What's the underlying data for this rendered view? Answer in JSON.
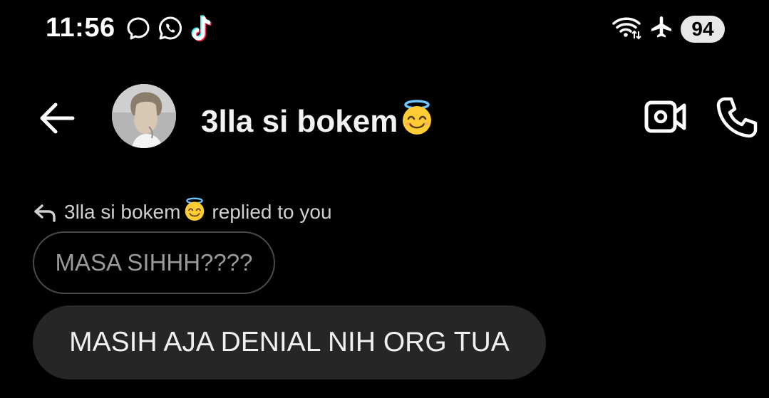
{
  "status_bar": {
    "time": "11:56",
    "left_icons": [
      "messenger-icon",
      "whatsapp-icon",
      "tiktok-icon"
    ],
    "right_icons": [
      "wifi-icon",
      "airplane-mode-icon"
    ],
    "battery_level": "94"
  },
  "header": {
    "contact_name": "3lla si bokem",
    "name_emoji": "smiling-face-with-halo-icon",
    "back_icon": "arrow-left-icon",
    "video_icon": "video-call-icon",
    "call_icon": "phone-icon"
  },
  "thread": {
    "reply_context": {
      "sender": "3lla si bokem",
      "text": "replied to you"
    },
    "quoted_message": "MASA SIHHH????",
    "message": "MASIH AJA DENIAL NIH ORG TUA"
  },
  "colors": {
    "background": "#000000",
    "bubble": "#262626",
    "quoted_border": "#4a4a4a",
    "quoted_text": "#9a9a9a",
    "text_primary": "#f2f2f2"
  }
}
